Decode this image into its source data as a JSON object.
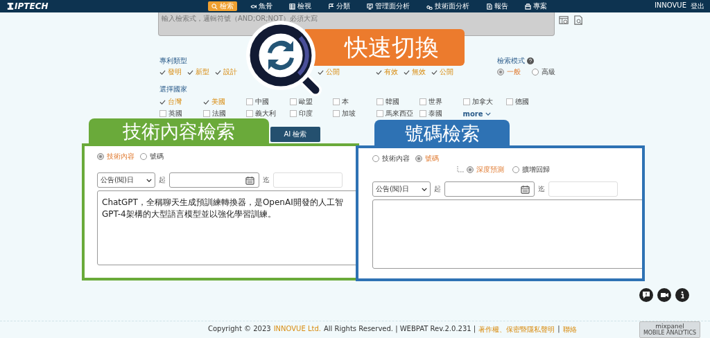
{
  "nav": {
    "logo": "IPTECH",
    "items": [
      {
        "label": "檢索",
        "selected": true
      },
      {
        "label": "魚骨",
        "selected": false
      },
      {
        "label": "檢視",
        "selected": false
      },
      {
        "label": "分類",
        "selected": false
      },
      {
        "label": "管理面分析",
        "selected": false
      },
      {
        "label": "技術面分析",
        "selected": false
      },
      {
        "label": "報告",
        "selected": false
      },
      {
        "label": "專案",
        "selected": false
      }
    ],
    "user": "INNOVUE",
    "logout": "登出"
  },
  "search": {
    "placeholder": "輸入檢索式，邏輯符號（AND;OR;NOT）必須大寫"
  },
  "patent_types": {
    "label": "專利類型",
    "items": [
      {
        "label": "發明",
        "checked": true
      },
      {
        "label": "新型",
        "checked": true
      },
      {
        "label": "設計",
        "checked": true
      },
      {
        "label": "公開",
        "checked": true
      }
    ]
  },
  "status": {
    "items": [
      {
        "label": "有效",
        "checked": true
      },
      {
        "label": "無效",
        "checked": true
      },
      {
        "label": "公開",
        "checked": true
      }
    ]
  },
  "search_mode": {
    "label": "檢索模式",
    "options": [
      {
        "label": "一般",
        "selected": true
      },
      {
        "label": "高級",
        "selected": false
      }
    ]
  },
  "countries": {
    "label": "選擇國家",
    "items": [
      {
        "label": "台灣",
        "checked": true
      },
      {
        "label": "美國",
        "checked": true
      },
      {
        "label": "中國",
        "checked": false
      },
      {
        "label": "歐盟",
        "checked": false
      },
      {
        "label": "本",
        "checked": false
      },
      {
        "label": "韓國",
        "checked": false
      },
      {
        "label": "世界",
        "checked": false
      },
      {
        "label": "加拿大",
        "checked": false
      },
      {
        "label": "德國",
        "checked": false
      },
      {
        "label": "英國",
        "checked": false
      },
      {
        "label": "法國",
        "checked": false
      },
      {
        "label": "義大利",
        "checked": false
      },
      {
        "label": "印度",
        "checked": false
      },
      {
        "label": "加坡",
        "checked": false
      },
      {
        "label": "馬來西亞",
        "checked": false
      },
      {
        "label": "泰國",
        "checked": false
      }
    ],
    "more": "more"
  },
  "callout": "快速切換",
  "tech_panel": {
    "tab": "技術內容檢索",
    "ai_button": "AI 檢索",
    "modes": [
      {
        "label": "技術內容",
        "selected": true
      },
      {
        "label": "號碼",
        "selected": false
      }
    ],
    "date_type": "公告(閱)日",
    "from": "起",
    "to": "迄",
    "query": "ChatGPT，全稱聊天生成預訓練轉換器，是OpenAI開發的人工智\nGPT-4架構的大型語言模型並以強化學習訓練。"
  },
  "number_panel": {
    "tab": "號碼檢索",
    "modes": [
      {
        "label": "技術內容",
        "selected": false
      },
      {
        "label": "號碼",
        "selected": true
      }
    ],
    "sub_modes": [
      {
        "label": "深度預測",
        "selected": true
      },
      {
        "label": "擴增回歸",
        "selected": false
      }
    ],
    "date_type": "公告(閱)日",
    "from": "起",
    "to": "迄"
  },
  "footer": [
    {
      "kind": "text",
      "text": "Copyright © 2023"
    },
    {
      "kind": "link",
      "text": "INNOVUE Ltd."
    },
    {
      "kind": "text",
      "text": "All Rights Reserved. | WEBPAT Rev.2.0.231 |"
    },
    {
      "kind": "link",
      "text": "著作權、保密暨隱私聲明"
    },
    {
      "kind": "text",
      "text": "|"
    },
    {
      "kind": "link",
      "text": "聯絡"
    }
  ],
  "badge": {
    "name": "mixpanel",
    "sub": "MOBILE ANALYTICS"
  }
}
